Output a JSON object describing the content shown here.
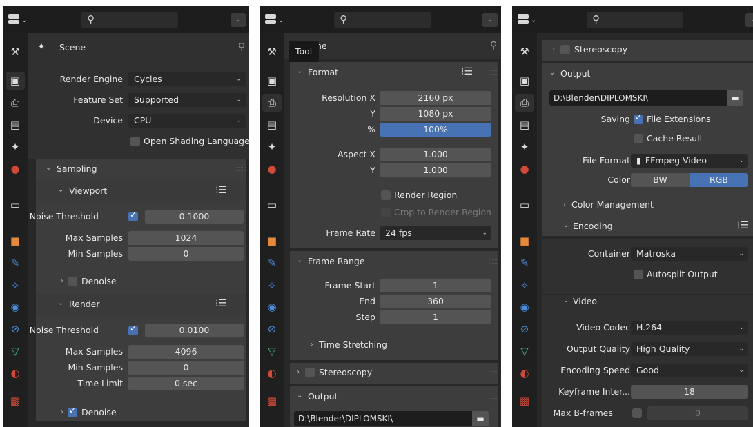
{
  "colors": {
    "accent": "#4772b3",
    "background": "#303030",
    "header": "#1d1d1d"
  },
  "icons": [
    "editor-type-icon",
    "search-icon",
    "tool-icon",
    "render-icon",
    "output-icon",
    "view-layer-icon",
    "scene-icon",
    "world-icon",
    "collection-icon",
    "object-icon",
    "modifier-icon",
    "particles-icon",
    "physics-icon",
    "constraints-icon",
    "data-icon",
    "material-icon",
    "texture-icon",
    "pin-icon",
    "folder-icon",
    "list-icon",
    "film-icon"
  ],
  "panel1": {
    "scene_title": "Scene",
    "render_engine_label": "Render Engine",
    "render_engine_value": "Cycles",
    "feature_set_label": "Feature Set",
    "feature_set_value": "Supported",
    "device_label": "Device",
    "device_value": "CPU",
    "osl_label": "Open Shading Language",
    "sampling_label": "Sampling",
    "viewport_label": "Viewport",
    "vp_noise_label": "Noise Threshold",
    "vp_noise_value": "0.1000",
    "vp_max_label": "Max Samples",
    "vp_max_value": "1024",
    "vp_min_label": "Min Samples",
    "vp_min_value": "0",
    "vp_denoise_label": "Denoise",
    "render_label": "Render",
    "r_noise_label": "Noise Threshold",
    "r_noise_value": "0.0100",
    "r_max_label": "Max Samples",
    "r_max_value": "4096",
    "r_min_label": "Min Samples",
    "r_min_value": "0",
    "r_time_label": "Time Limit",
    "r_time_value": "0 sec",
    "r_denoise_label": "Denoise"
  },
  "panel2": {
    "tooltip": "Tool",
    "scene_partial": "ne",
    "format_label": "Format",
    "res_x_label": "Resolution X",
    "res_x_value": "2160 px",
    "res_y_label": "Y",
    "res_y_value": "1080 px",
    "pct_label": "%",
    "pct_value": "100%",
    "aspect_x_label": "Aspect X",
    "aspect_x_value": "1.000",
    "aspect_y_label": "Y",
    "aspect_y_value": "1.000",
    "render_region_label": "Render Region",
    "crop_label": "Crop to Render Region",
    "frame_rate_label": "Frame Rate",
    "frame_rate_value": "24 fps",
    "frame_range_label": "Frame Range",
    "frame_start_label": "Frame Start",
    "frame_start_value": "1",
    "end_label": "End",
    "end_value": "360",
    "step_label": "Step",
    "step_value": "1",
    "time_stretching_label": "Time Stretching",
    "stereoscopy_label": "Stereoscopy",
    "output_label": "Output",
    "path_value": "D:\\Blender\\DIPLOMSKI\\"
  },
  "panel3": {
    "stereoscopy_label": "Stereoscopy",
    "output_label": "Output",
    "path_value": "D:\\Blender\\DIPLOMSKI\\",
    "saving_label": "Saving",
    "file_ext_label": "File Extensions",
    "cache_label": "Cache Result",
    "file_format_label": "File Format",
    "file_format_value": "FFmpeg Video",
    "color_label": "Color",
    "bw_label": "BW",
    "rgb_label": "RGB",
    "color_mgmt_label": "Color Management",
    "encoding_label": "Encoding",
    "container_label": "Container",
    "container_value": "Matroska",
    "autosplit_label": "Autosplit Output",
    "video_label": "Video",
    "codec_label": "Video Codec",
    "codec_value": "H.264",
    "quality_label": "Output Quality",
    "quality_value": "High Quality",
    "speed_label": "Encoding Speed",
    "speed_value": "Good",
    "keyframe_label": "Keyframe Inter...",
    "keyframe_value": "18",
    "bframes_label": "Max B-frames",
    "bframes_value": "0"
  }
}
